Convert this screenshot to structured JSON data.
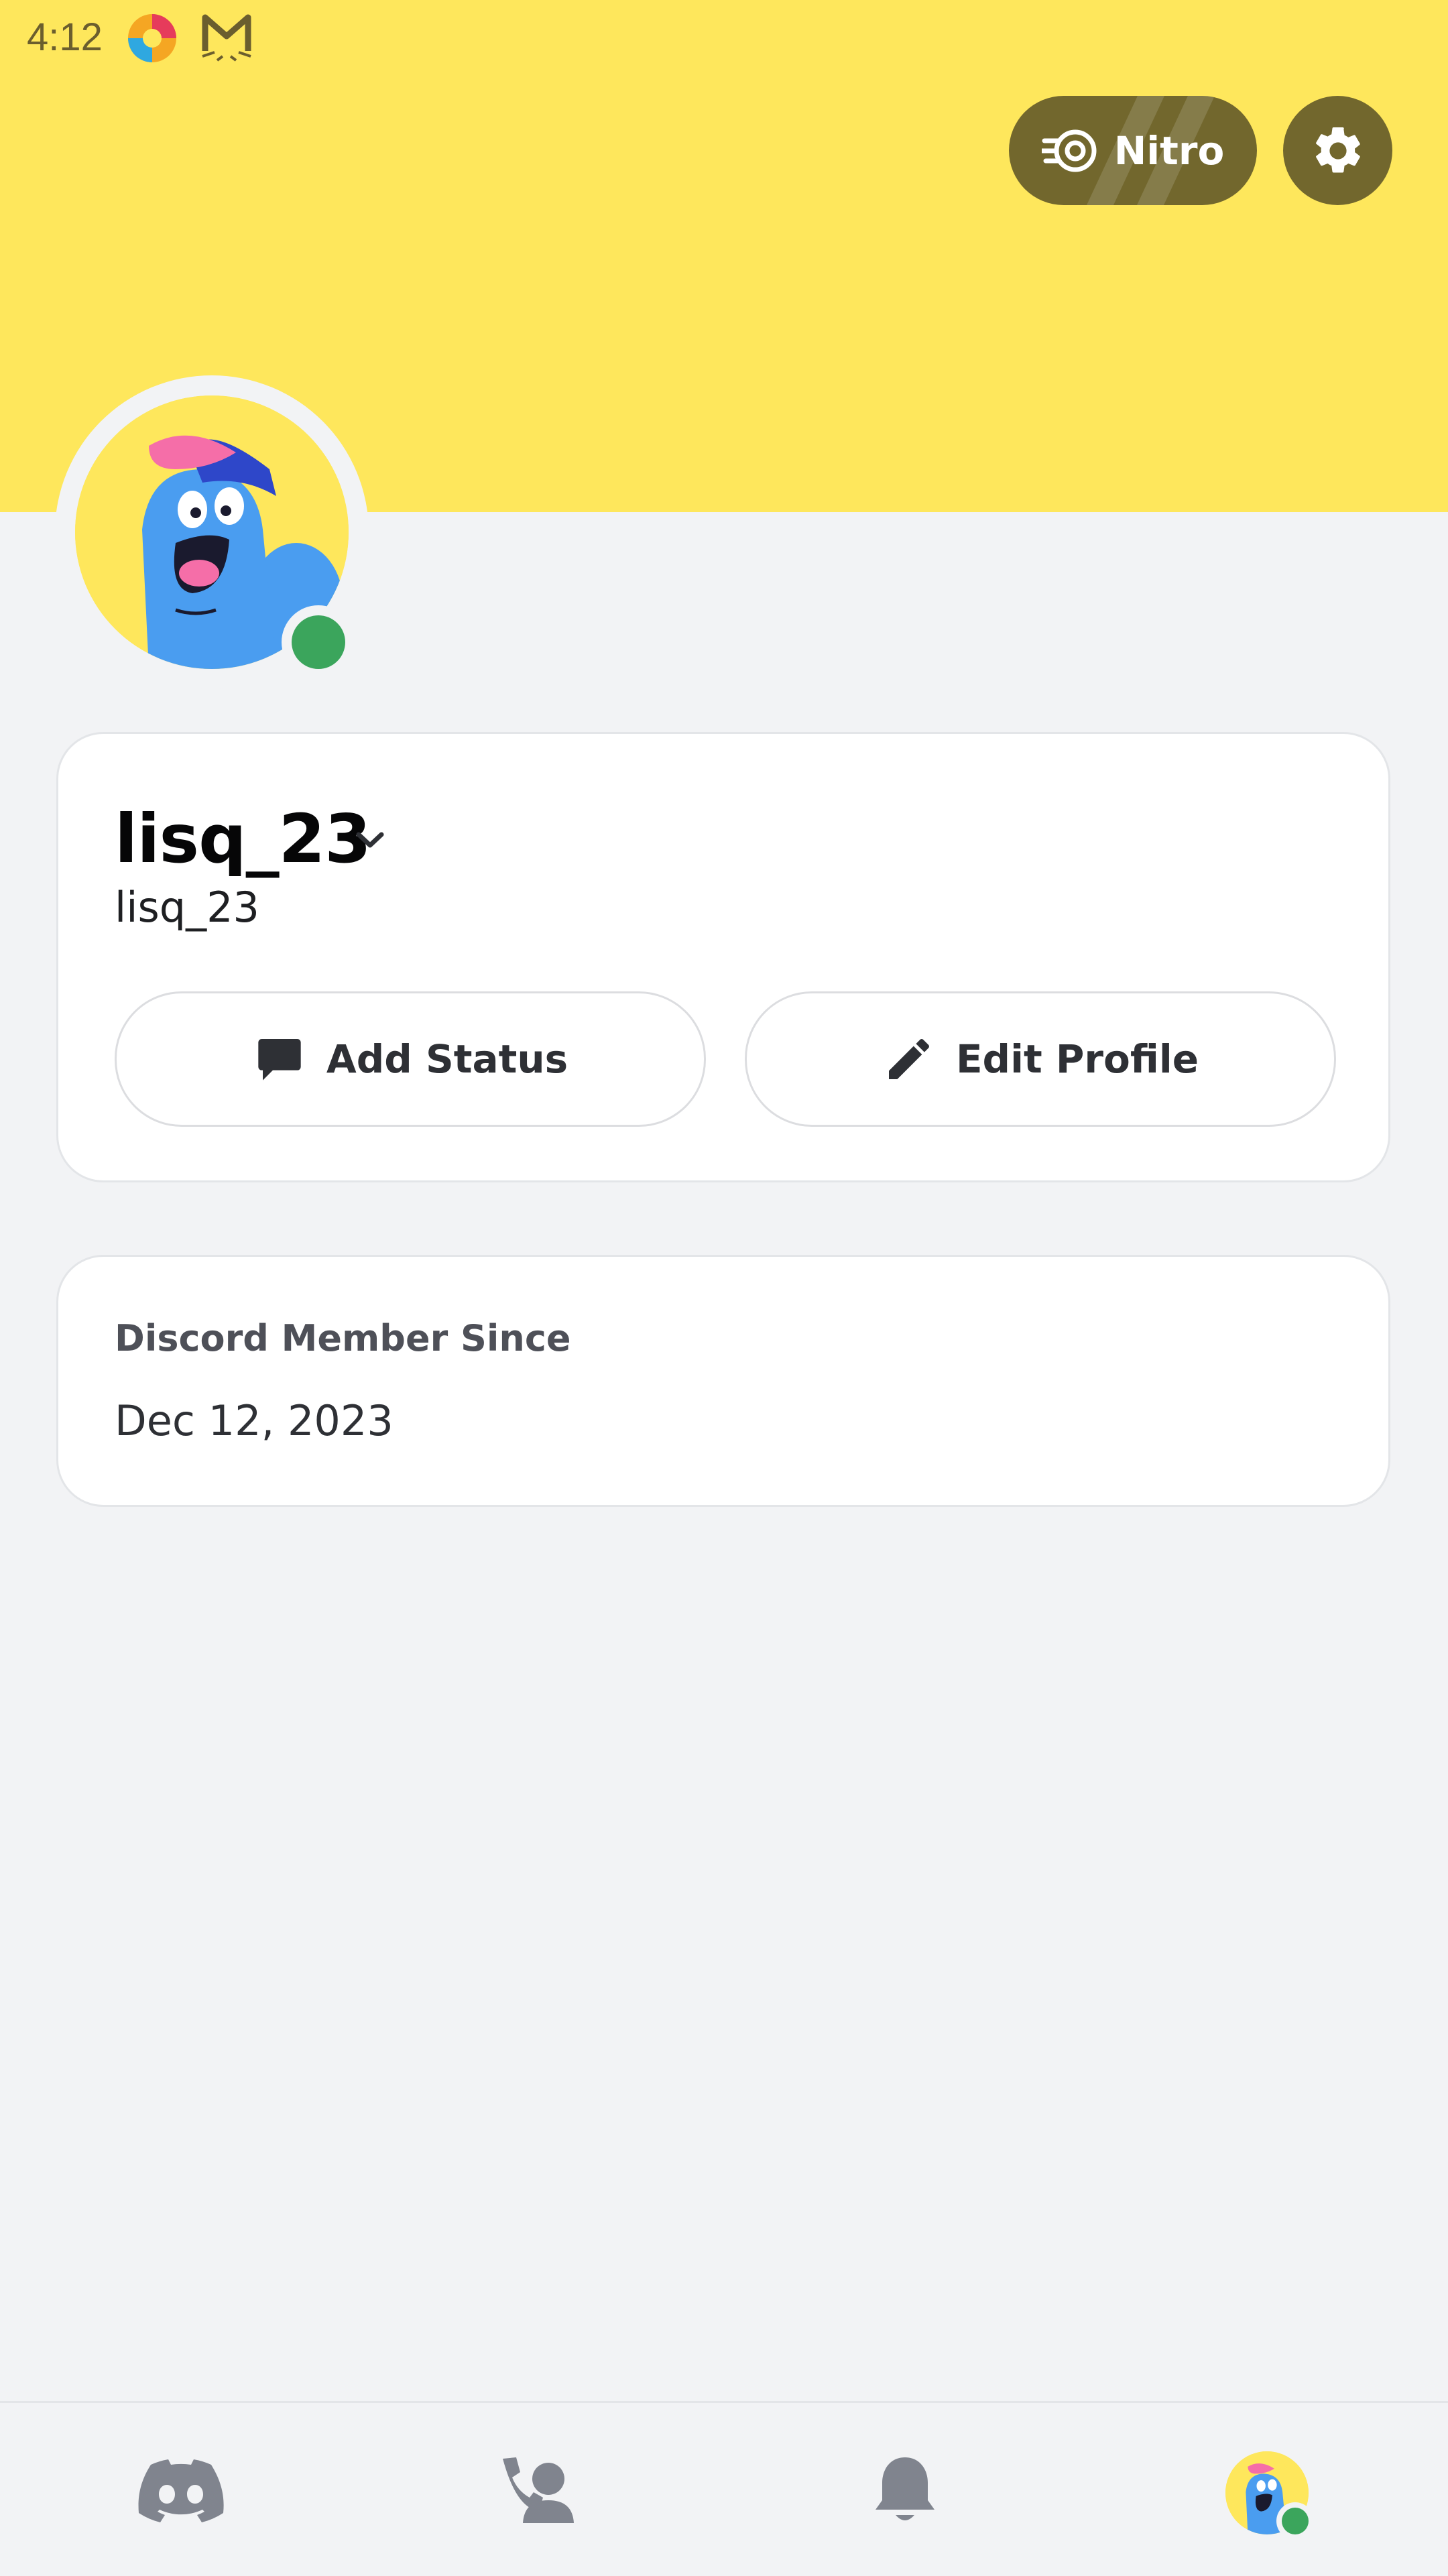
{
  "status_bar": {
    "time": "4:12",
    "icons": [
      "browser-app-icon",
      "mail-cat-icon"
    ]
  },
  "header": {
    "nitro_label": "Nitro",
    "settings_icon": "gear-icon"
  },
  "colors": {
    "banner": "#fee75c",
    "button_dark": "#72672d",
    "online": "#3ba55c",
    "background": "#f2f3f5"
  },
  "profile": {
    "display_name": "lisq_23",
    "username": "lisq_23",
    "status": "online",
    "add_status_label": "Add Status",
    "edit_profile_label": "Edit Profile"
  },
  "member_card": {
    "label": "Discord Member Since",
    "date": "Dec 12, 2023"
  },
  "bottom_nav": {
    "items": [
      "home-icon",
      "friends-icon",
      "notifications-icon",
      "profile-avatar"
    ],
    "active": "profile-avatar"
  }
}
